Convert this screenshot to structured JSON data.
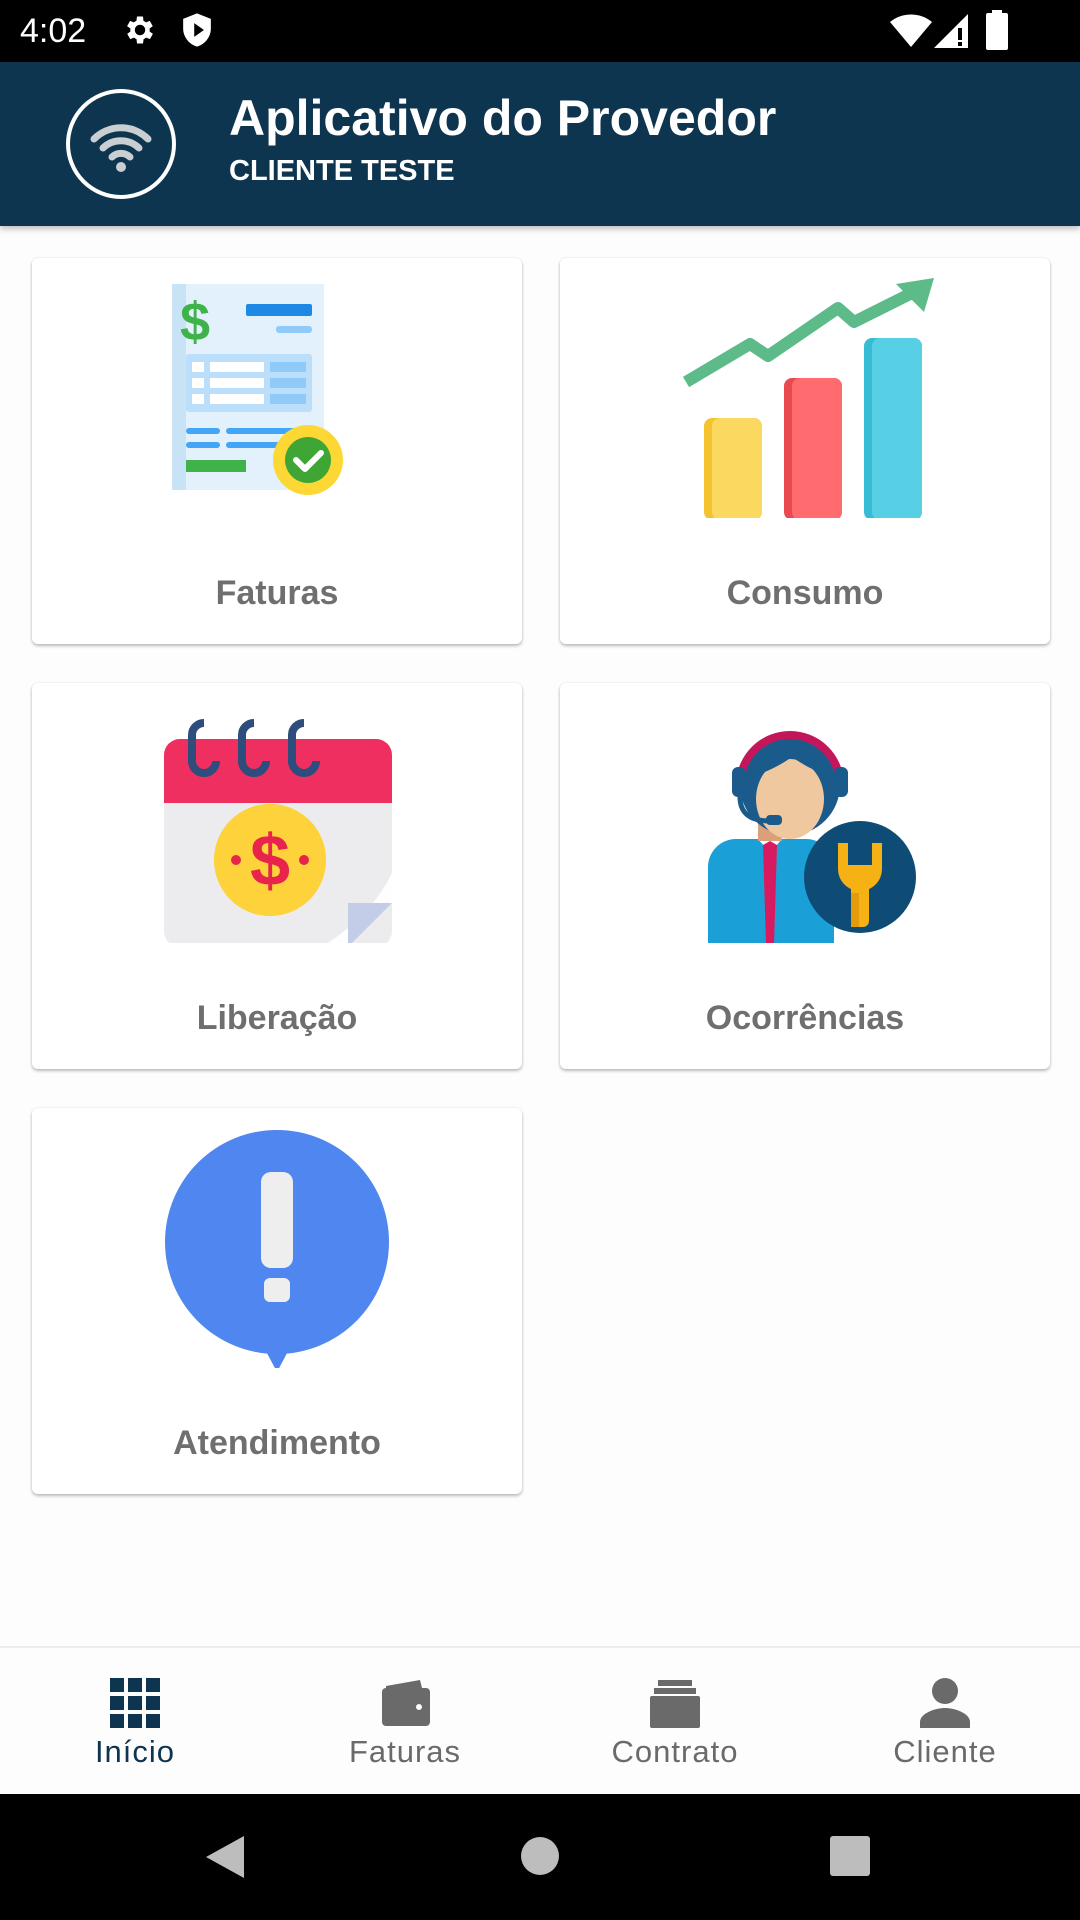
{
  "status_bar": {
    "time": "4:02",
    "left_icons": [
      "gear-icon",
      "shield-icon"
    ],
    "right_icons": [
      "wifi-icon",
      "signal-icon",
      "battery-icon"
    ]
  },
  "header": {
    "title": "Aplicativo do Provedor",
    "subtitle": "CLIENTE TESTE",
    "logo_icon": "wifi-icon"
  },
  "grid": {
    "cards": [
      {
        "label": "Faturas",
        "icon": "invoice-icon"
      },
      {
        "label": "Consumo",
        "icon": "bar-chart-icon"
      },
      {
        "label": "Liberação",
        "icon": "calendar-dollar-icon"
      },
      {
        "label": "Ocorrências",
        "icon": "support-agent-icon"
      },
      {
        "label": "Atendimento",
        "icon": "alert-bubble-icon"
      }
    ]
  },
  "bottom_nav": {
    "items": [
      {
        "label": "Início",
        "icon": "grid-icon",
        "active": true
      },
      {
        "label": "Faturas",
        "icon": "wallet-icon",
        "active": false
      },
      {
        "label": "Contrato",
        "icon": "archive-icon",
        "active": false
      },
      {
        "label": "Cliente",
        "icon": "person-icon",
        "active": false
      }
    ]
  },
  "system_nav": [
    "back-icon",
    "home-icon",
    "recents-icon"
  ],
  "colors": {
    "header_bg": "#0e3550",
    "active_nav": "#0e3550",
    "inactive_nav": "#6a6a6a",
    "card_label": "#6f6f6f"
  }
}
